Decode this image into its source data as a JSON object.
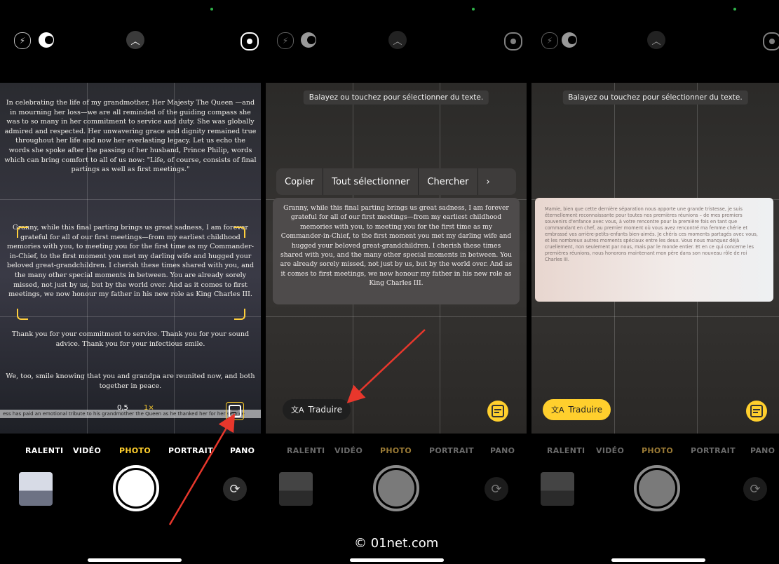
{
  "watermark": "© 01net.com",
  "modes": [
    "RALENTI",
    "VIDÉO",
    "PHOTO",
    "PORTRAIT",
    "PANO"
  ],
  "active_mode": "PHOTO",
  "panel1": {
    "para1": "In celebrating the life of my grandmother, Her Majesty The Queen —and in mourning her loss—we are all reminded of the guiding compass she was to so many in her commitment to service and duty. She was globally admired and respected. Her unwavering grace and dignity remained true throughout her life and now her everlasting legacy. Let us echo the words she spoke after the passing of her husband, Prince Philip, words which can bring comfort to all of us now: \"Life, of course, consists of final partings as well as first meetings.\"",
    "para2": "Granny, while this final parting brings us great sadness, I am forever grateful for all of our first meetings—from my earliest childhood memories with you, to meeting you for the first time as my Commander-in-Chief, to the first moment you met my darling wife and hugged your beloved great-grandchildren. I cherish these times shared with you, and the many other special moments in between. You are already sorely missed, not just by us, but by the world over. And as it comes to first meetings, we now honour my father in his new role as King Charles III.",
    "para3": "Thank you for your commitment to service. Thank you for your sound advice. Thank you for your infectious smile.",
    "para4": "We, too, smile knowing that you and grandpa are reunited now, and both together in peace.",
    "zoom_a": "0,5",
    "zoom_b": "1×",
    "ticker": "ess has paid an emotional tribute to his grandmother the Queen as he thanked her for her service"
  },
  "panel2": {
    "toast": "Balayez ou touchez pour sélectionner du texte.",
    "menu": [
      "Copier",
      "Tout sélectionner",
      "Chercher",
      "›"
    ],
    "card": "Granny, while this final parting brings us great sadness, I am forever grateful for all of our first meetings—from my earliest childhood memories with you, to meeting you for the first time as my Commander-in-Chief, to the first moment you met my darling wife and hugged your beloved great-grandchildren. I cherish these times shared with you, and the many other special moments in between. You are already sorely missed, not just by us, but by the world over. And as it comes to first meetings, we now honour my father in his new role as King Charles III.",
    "translate": "Traduire"
  },
  "panel3": {
    "toast": "Balayez ou touchez pour sélectionner du texte.",
    "card": "Mamie, bien que cette dernière séparation nous apporte une grande tristesse, je suis éternellement reconnaissante pour toutes nos premières réunions – de mes premiers souvenirs d'enfance avec vous, à votre rencontre pour la première fois en tant que commandant en chef, au premier moment où vous avez rencontré ma femme chérie et embrassé vos arrière-petits-enfants bien-aimés. Je chéris ces moments partagés avec vous, et les nombreux autres moments spéciaux entre les deux. Vous nous manquez déjà cruellement, non seulement par nous, mais par le monde entier. Et en ce qui concerne les premières réunions, nous honorons maintenant mon père dans son nouveau rôle de roi Charles III.",
    "translate": "Traduire"
  },
  "colors": {
    "accent": "#ffcf2d",
    "arrow": "#e8372c"
  }
}
